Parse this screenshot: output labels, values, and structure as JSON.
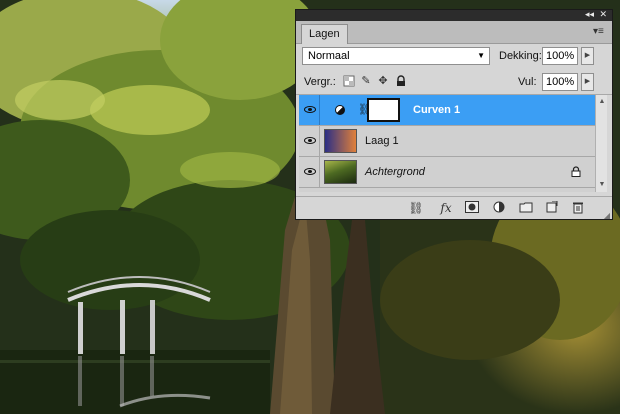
{
  "panel": {
    "tab_label": "Lagen",
    "collapse_glyph": "◂◂",
    "close_glyph": "✕",
    "menu_glyph": "▾≡"
  },
  "blend": {
    "mode": "Normaal",
    "opacity_label": "Dekking:",
    "opacity_value": "100%"
  },
  "lock": {
    "label": "Vergr.:",
    "fill_label": "Vul:",
    "fill_value": "100%",
    "icons": [
      "lock-transparency-icon",
      "lock-pixels-icon",
      "lock-position-icon",
      "lock-all-icon"
    ]
  },
  "layers": [
    {
      "name": "Curven 1",
      "selected": true,
      "type": "adjustment-curves",
      "visible": true
    },
    {
      "name": "Laag 1",
      "selected": false,
      "type": "gradient",
      "visible": true
    },
    {
      "name": "Achtergrond",
      "selected": false,
      "type": "background",
      "visible": true,
      "locked": true
    }
  ],
  "toolbar": {
    "icons": [
      "link-layers-icon",
      "layer-style-fx-icon",
      "add-mask-icon",
      "adjustment-layer-icon",
      "new-group-icon",
      "new-layer-icon",
      "trash-icon"
    ],
    "fx_label": "fx"
  },
  "colors": {
    "selection": "#3b9ef4",
    "panel_bg": "#d6d6d6",
    "gradient_from": "#2b2f86",
    "gradient_to": "#e0803a"
  }
}
